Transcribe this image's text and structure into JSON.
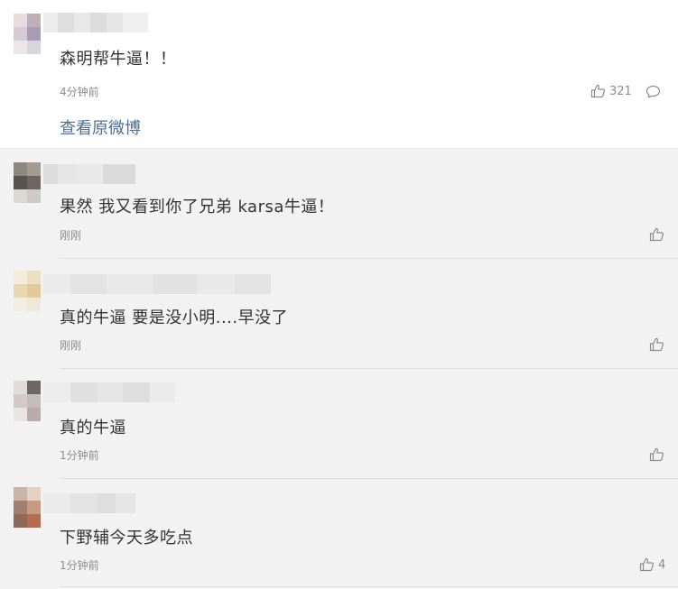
{
  "main_comment": {
    "text": "森明帮牛逼！！",
    "time": "4分钟前",
    "like_count": "321",
    "view_original_label": "查看原微博"
  },
  "replies": [
    {
      "text": "果然 我又看到你了兄弟 karsa牛逼！",
      "time": "刚刚",
      "like_count": ""
    },
    {
      "text": "真的牛逼 要是没小明....早没了",
      "time": "刚刚",
      "like_count": ""
    },
    {
      "text": "真的牛逼",
      "time": "1分钟前",
      "like_count": ""
    },
    {
      "text": "下野辅今天多吃点",
      "time": "1分钟前",
      "like_count": "4"
    }
  ],
  "icons": {
    "like": "thumbs-up-icon",
    "reply": "comment-bubble-icon"
  },
  "colors": {
    "link": "#4e6f97",
    "meta": "#8c8c8c",
    "page_bg": "#f2f2f2",
    "card_bg": "#ffffff"
  }
}
